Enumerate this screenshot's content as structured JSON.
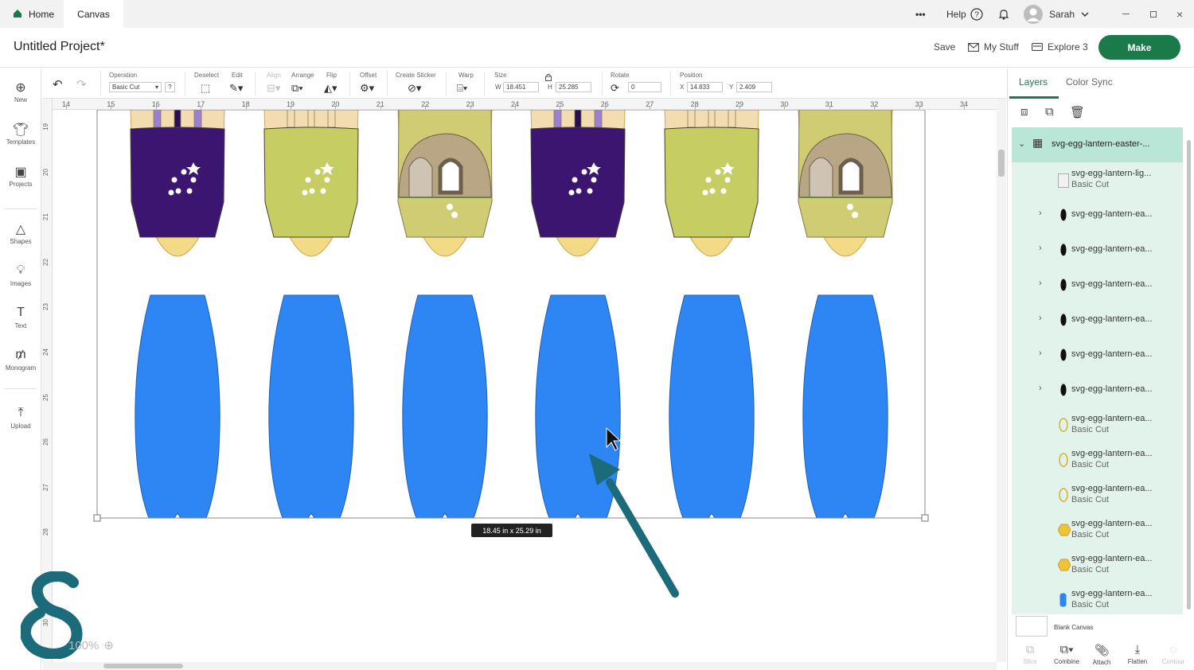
{
  "titlebar": {
    "tabs": [
      {
        "label": "Home"
      },
      {
        "label": "Canvas"
      }
    ],
    "more_label": "•••",
    "help_label": "Help",
    "user_name": "Sarah"
  },
  "header": {
    "project_title": "Untitled Project*",
    "save_label": "Save",
    "mystuff_label": "My Stuff",
    "explore_label": "Explore 3",
    "make_label": "Make"
  },
  "toolbar": {
    "operation_label": "Operation",
    "operation_value": "Basic Cut",
    "deselect_label": "Deselect",
    "edit_label": "Edit",
    "align_label": "Align",
    "arrange_label": "Arrange",
    "flip_label": "Flip",
    "offset_label": "Offset",
    "sticker_label": "Create Sticker",
    "warp_label": "Warp",
    "size_label": "Size",
    "w_prefix": "W",
    "w_value": "18.451",
    "h_prefix": "H",
    "h_value": "25.285",
    "rotate_label": "Rotate",
    "rotate_value": "0",
    "position_label": "Position",
    "x_prefix": "X",
    "x_value": "14.833",
    "y_prefix": "Y",
    "y_value": "2.409"
  },
  "leftnav": [
    {
      "label": "New"
    },
    {
      "label": "Templates"
    },
    {
      "label": "Projects"
    },
    {
      "label": "Shapes"
    },
    {
      "label": "Images"
    },
    {
      "label": "Text"
    },
    {
      "label": "Monogram"
    },
    {
      "label": "Upload"
    }
  ],
  "rulers": {
    "top": [
      "14",
      "15",
      "16",
      "17",
      "18",
      "19",
      "20",
      "21",
      "22",
      "23",
      "24",
      "25",
      "26",
      "27",
      "28",
      "29",
      "30",
      "31",
      "32",
      "33",
      "34"
    ],
    "left": [
      "19",
      "20",
      "21",
      "22",
      "23",
      "24",
      "25",
      "26",
      "27",
      "28",
      "29",
      "30"
    ]
  },
  "canvas": {
    "dimension_label": "18.45  in x 25.29  in",
    "zoom": "100%",
    "lantern_top_colors": [
      "#3b1570",
      "#c6cd63",
      "tomb",
      "#3b1570",
      "#c6cd63",
      "tomb"
    ],
    "lantern_bottom_color": "#2e86f5",
    "arrow_color": "#1b6b7a"
  },
  "rpanel": {
    "tabs": [
      {
        "label": "Layers"
      },
      {
        "label": "Color Sync"
      }
    ],
    "group_name": "svg-egg-lantern-easter-...",
    "layers": [
      {
        "name": "svg-egg-lantern-lig...",
        "op": "Basic Cut"
      },
      {
        "name": "svg-egg-lantern-ea..."
      },
      {
        "name": "svg-egg-lantern-ea..."
      },
      {
        "name": "svg-egg-lantern-ea..."
      },
      {
        "name": "svg-egg-lantern-ea..."
      },
      {
        "name": "svg-egg-lantern-ea..."
      },
      {
        "name": "svg-egg-lantern-ea..."
      },
      {
        "name": "svg-egg-lantern-ea...",
        "op": "Basic Cut"
      },
      {
        "name": "svg-egg-lantern-ea...",
        "op": "Basic Cut"
      },
      {
        "name": "svg-egg-lantern-ea...",
        "op": "Basic Cut"
      },
      {
        "name": "svg-egg-lantern-ea...",
        "op": "Basic Cut"
      },
      {
        "name": "svg-egg-lantern-ea...",
        "op": "Basic Cut"
      },
      {
        "name": "svg-egg-lantern-ea...",
        "op": "Basic Cut"
      }
    ],
    "blank_canvas_label": "Blank Canvas",
    "tools": [
      {
        "label": "Slice"
      },
      {
        "label": "Combine"
      },
      {
        "label": "Attach"
      },
      {
        "label": "Flatten"
      },
      {
        "label": "Contour"
      }
    ]
  }
}
